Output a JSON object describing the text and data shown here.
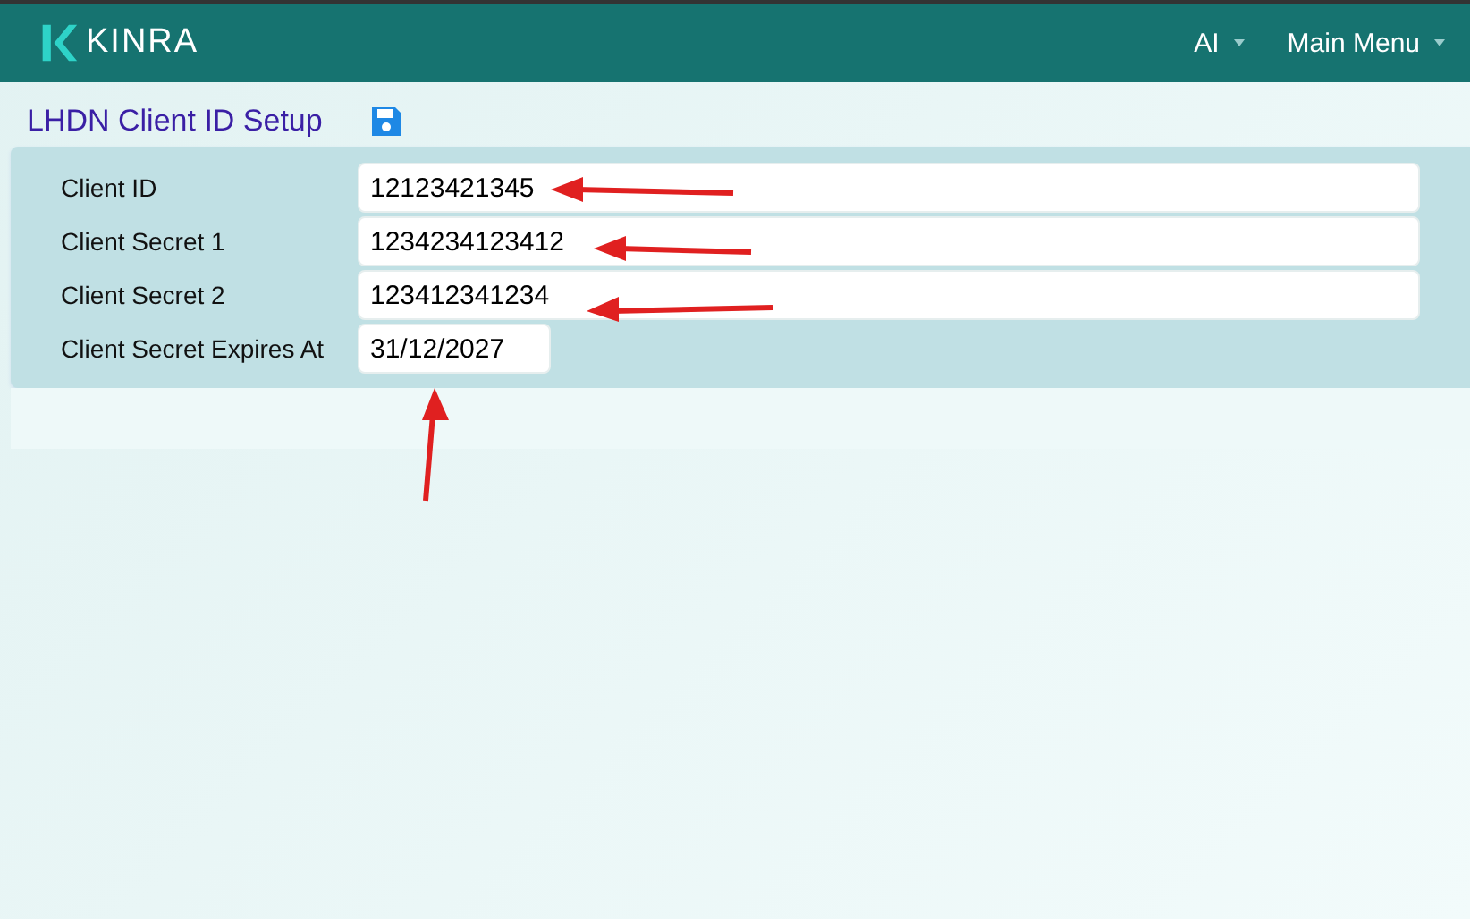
{
  "header": {
    "brand": "KINRA",
    "menus": [
      {
        "label": "AI"
      },
      {
        "label": "Main Menu"
      }
    ]
  },
  "page": {
    "title": "LHDN Client ID Setup"
  },
  "form": {
    "fields": [
      {
        "label": "Client ID",
        "value": "12123421345",
        "kind": "wide"
      },
      {
        "label": "Client Secret 1",
        "value": "1234234123412",
        "kind": "wide"
      },
      {
        "label": "Client Secret 2",
        "value": "123412341234",
        "kind": "wide"
      },
      {
        "label": "Client Secret Expires At",
        "value": "31/12/2027",
        "kind": "date"
      }
    ]
  }
}
